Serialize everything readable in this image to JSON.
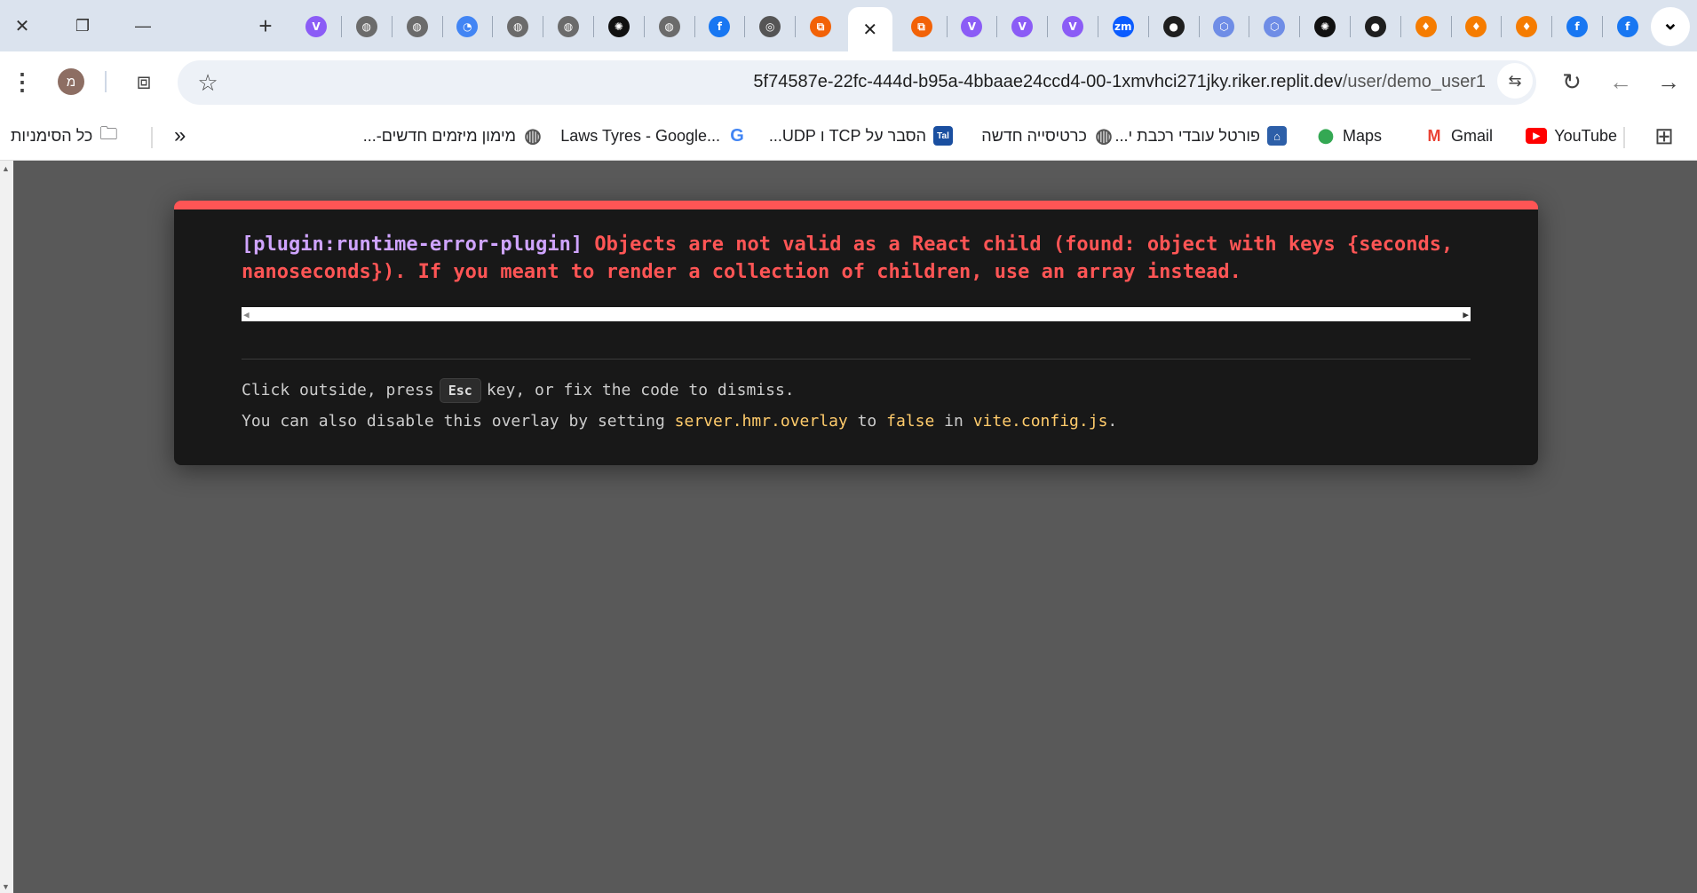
{
  "window_controls": [
    {
      "name": "close-window",
      "glyph": "✕"
    },
    {
      "name": "restore-window",
      "glyph": "❐"
    },
    {
      "name": "minimize-window",
      "glyph": "—"
    }
  ],
  "new_tab_glyph": "+",
  "tabs": [
    {
      "icon": "vite-icon",
      "glyph": "V",
      "bg": "#8b5cf6"
    },
    {
      "icon": "globe-icon",
      "glyph": "◍",
      "bg": "#6b6b6b"
    },
    {
      "icon": "globe-icon",
      "glyph": "◍",
      "bg": "#6b6b6b"
    },
    {
      "icon": "google-lens-icon",
      "glyph": "◔",
      "bg": "#4285f4"
    },
    {
      "icon": "globe-icon",
      "glyph": "◍",
      "bg": "#6b6b6b"
    },
    {
      "icon": "globe-icon",
      "glyph": "◍",
      "bg": "#6b6b6b"
    },
    {
      "icon": "openai-icon",
      "glyph": "✺",
      "bg": "#111111"
    },
    {
      "icon": "globe-icon",
      "glyph": "◍",
      "bg": "#6b6b6b"
    },
    {
      "icon": "facebook-icon",
      "glyph": "f",
      "bg": "#1877f2"
    },
    {
      "icon": "chrome-icon",
      "glyph": "◎",
      "bg": "#555555"
    },
    {
      "icon": "replit-icon",
      "glyph": "⧉",
      "bg": "#f26207"
    },
    {
      "icon": "close-icon",
      "glyph": "✕",
      "bg": "transparent",
      "active": true
    },
    {
      "icon": "replit-icon",
      "glyph": "⧉",
      "bg": "#f26207"
    },
    {
      "icon": "vite-icon",
      "glyph": "V",
      "bg": "#8b5cf6"
    },
    {
      "icon": "vite-icon",
      "glyph": "V",
      "bg": "#8b5cf6"
    },
    {
      "icon": "vite-icon",
      "glyph": "V",
      "bg": "#8b5cf6"
    },
    {
      "icon": "zoom-icon",
      "glyph": "zm",
      "bg": "#0b5cff"
    },
    {
      "icon": "github-icon",
      "glyph": "●",
      "bg": "#1f1f1f"
    },
    {
      "icon": "cube-icon",
      "glyph": "⬡",
      "bg": "#6f8de6"
    },
    {
      "icon": "cube-icon",
      "glyph": "⬡",
      "bg": "#6f8de6"
    },
    {
      "icon": "openai-icon",
      "glyph": "✺",
      "bg": "#111111"
    },
    {
      "icon": "github-icon",
      "glyph": "●",
      "bg": "#1f1f1f"
    },
    {
      "icon": "firebase-icon",
      "glyph": "♦",
      "bg": "#f57c00"
    },
    {
      "icon": "firebase-icon",
      "glyph": "♦",
      "bg": "#f57c00"
    },
    {
      "icon": "firebase-icon",
      "glyph": "♦",
      "bg": "#f57c00"
    },
    {
      "icon": "facebook-icon",
      "glyph": "f",
      "bg": "#1877f2"
    },
    {
      "icon": "facebook-icon",
      "glyph": "f",
      "bg": "#1877f2"
    }
  ],
  "tab_dropdown_glyph": "⌄",
  "toolbar": {
    "menu_glyph": "⋮",
    "profile_initial": "מ",
    "profile_bg": "#8d6e63",
    "extensions_glyph": "⧈",
    "star_glyph": "☆",
    "url_host": "5f74587e-22fc-444d-b95a-4bbaae24ccd4-00-1xmvhci271jky.riker.replit.dev",
    "url_path": "/user/demo_user1",
    "site_settings_glyph": "⇆",
    "reload_glyph": "↻",
    "back_glyph": "←",
    "forward_glyph": "→"
  },
  "bookmarks": {
    "apps_glyph": "⊞",
    "items": [
      {
        "label": "YouTube",
        "icon": "youtube-icon",
        "glyph": "▶",
        "bg": "#ff0000"
      },
      {
        "label": "Gmail",
        "icon": "gmail-icon",
        "glyph": "M",
        "bg": "#ea4335"
      },
      {
        "label": "Maps",
        "icon": "maps-pin-icon",
        "glyph": "⬤",
        "bg": "#34a853"
      },
      {
        "label": "פורטל עובדי רכבת י...",
        "icon": "lock-portal-icon",
        "glyph": "🔒",
        "bg": "#2d5fa8"
      },
      {
        "label": "כרטיסייה חדשה",
        "icon": "globe-icon",
        "glyph": "◍",
        "bg": "#555555"
      },
      {
        "label": "הסבר על TCP ו UDP...",
        "icon": "tal-icon",
        "glyph": "Tal",
        "bg": "#1a4fa0"
      },
      {
        "label": "Laws Tyres - Google...",
        "icon": "google-icon",
        "glyph": "G",
        "bg": "#4285f4"
      },
      {
        "label": "מימון מיזמים חדשים-...",
        "icon": "globe-icon",
        "glyph": "◍",
        "bg": "#555555"
      }
    ],
    "more_glyph": "»",
    "all_bookmarks_label": "כל הסימניות",
    "folder_glyph": "🗀"
  },
  "error": {
    "accent": "#ff5555",
    "plugin_tag": "[plugin:runtime-error-plugin]",
    "message": "Objects are not valid as a React child (found: object with keys {seconds, nanoseconds}). If you meant to render a collection of children, use an array instead.",
    "tip1_before": "Click outside, press",
    "tip1_key": "Esc",
    "tip1_after": "key, or fix the code to dismiss.",
    "tip2_prefix": "You can also disable this overlay by setting",
    "tip2_code1": "server.hmr.overlay",
    "tip2_mid1": "to",
    "tip2_code2": "false",
    "tip2_mid2": "in",
    "tip2_code3": "vite.config.js",
    "tip2_end": "."
  }
}
